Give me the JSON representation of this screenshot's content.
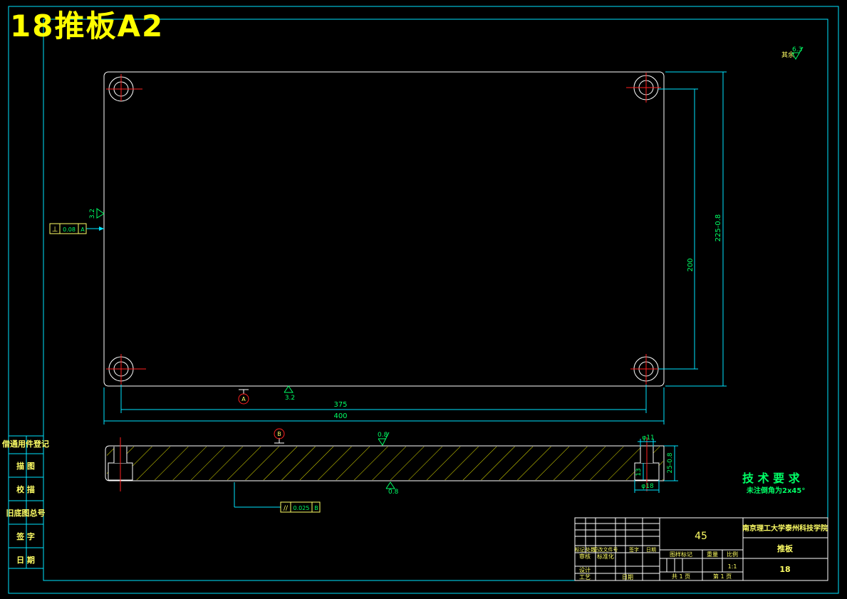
{
  "sheet_title": "18推板A2",
  "roughness": {
    "general": "6.3",
    "general_prefix": "其余",
    "left_face": "3.2",
    "bottom_face": "3.2",
    "section_top": "0.8",
    "section_bottom": "0.8"
  },
  "datums": {
    "a": "A",
    "b": "B"
  },
  "tolerances": {
    "perpendicularity": {
      "symbol": "⊥",
      "value": "0.08",
      "datum": "A"
    },
    "parallelism": {
      "symbol": "//",
      "value": "0.025",
      "datum": "B"
    }
  },
  "dimensions": {
    "hole_spacing_x": "375",
    "overall_width": "400",
    "hole_spacing_y": "200",
    "overall_height": "225-0.8",
    "counterbore_dia": "φ11",
    "counterbore_outer": "φ18",
    "thickness": "25-0.8",
    "counterbore_depth": "13"
  },
  "side_labels": [
    "借通用件登记",
    "描 图",
    "校 描",
    "旧底图总号",
    "签 字",
    "日 期"
  ],
  "tech_requirements": {
    "heading": "技 术 要 求",
    "line1": "未注倒角为2x45°"
  },
  "title_block": {
    "material": "45",
    "school": "南京理工大学泰州科技学院",
    "part_name": "推板",
    "drawing_no": "18",
    "rev_headers": [
      "标记",
      "处数",
      "更改文件号",
      "签字",
      "日期"
    ],
    "sign_labels": [
      "设计",
      "标准化",
      "审核",
      "工艺",
      "日期"
    ],
    "stage_labels": [
      "图样标记",
      "重量",
      "比例"
    ],
    "scale": "1:1",
    "sheet_total": "共 1 页",
    "sheet_num": "第 1 页"
  }
}
